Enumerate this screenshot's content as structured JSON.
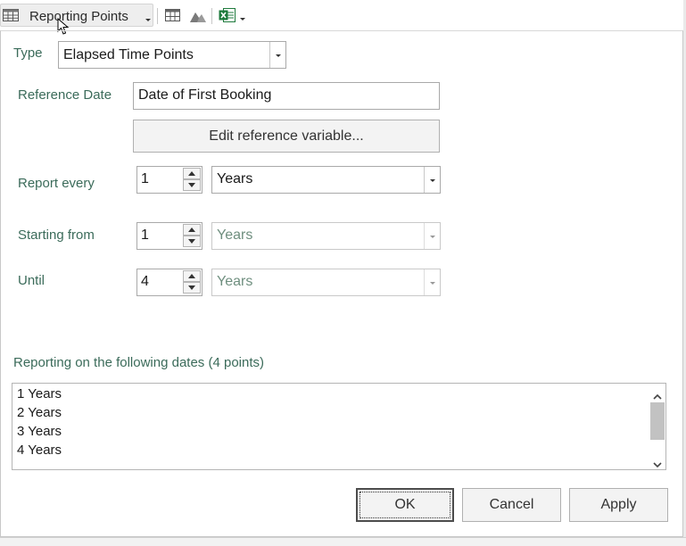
{
  "toolbar": {
    "menu_label": "Reporting Points",
    "icons": [
      "table-grid-icon",
      "table-icon",
      "chart-icon",
      "excel-icon"
    ]
  },
  "form": {
    "type": {
      "label": "Type",
      "value": "Elapsed Time Points"
    },
    "reference_date": {
      "label": "Reference Date",
      "value": "Date of First Booking",
      "edit_button": "Edit reference variable..."
    },
    "report_every": {
      "label": "Report every",
      "number": "1",
      "unit": "Years"
    },
    "starting_from": {
      "label": "Starting from",
      "number": "1",
      "unit": "Years"
    },
    "until": {
      "label": "Until",
      "number": "4",
      "unit": "Years"
    }
  },
  "dates": {
    "heading": "Reporting on the following dates (4 points)",
    "items": [
      "1 Years",
      "2 Years",
      "3 Years",
      "4 Years"
    ]
  },
  "buttons": {
    "ok": "OK",
    "cancel": "Cancel",
    "apply": "Apply"
  },
  "colors": {
    "label": "#3b6b5a",
    "disabled_text": "#6f8f7f",
    "excel_green": "#1e7a3c"
  }
}
